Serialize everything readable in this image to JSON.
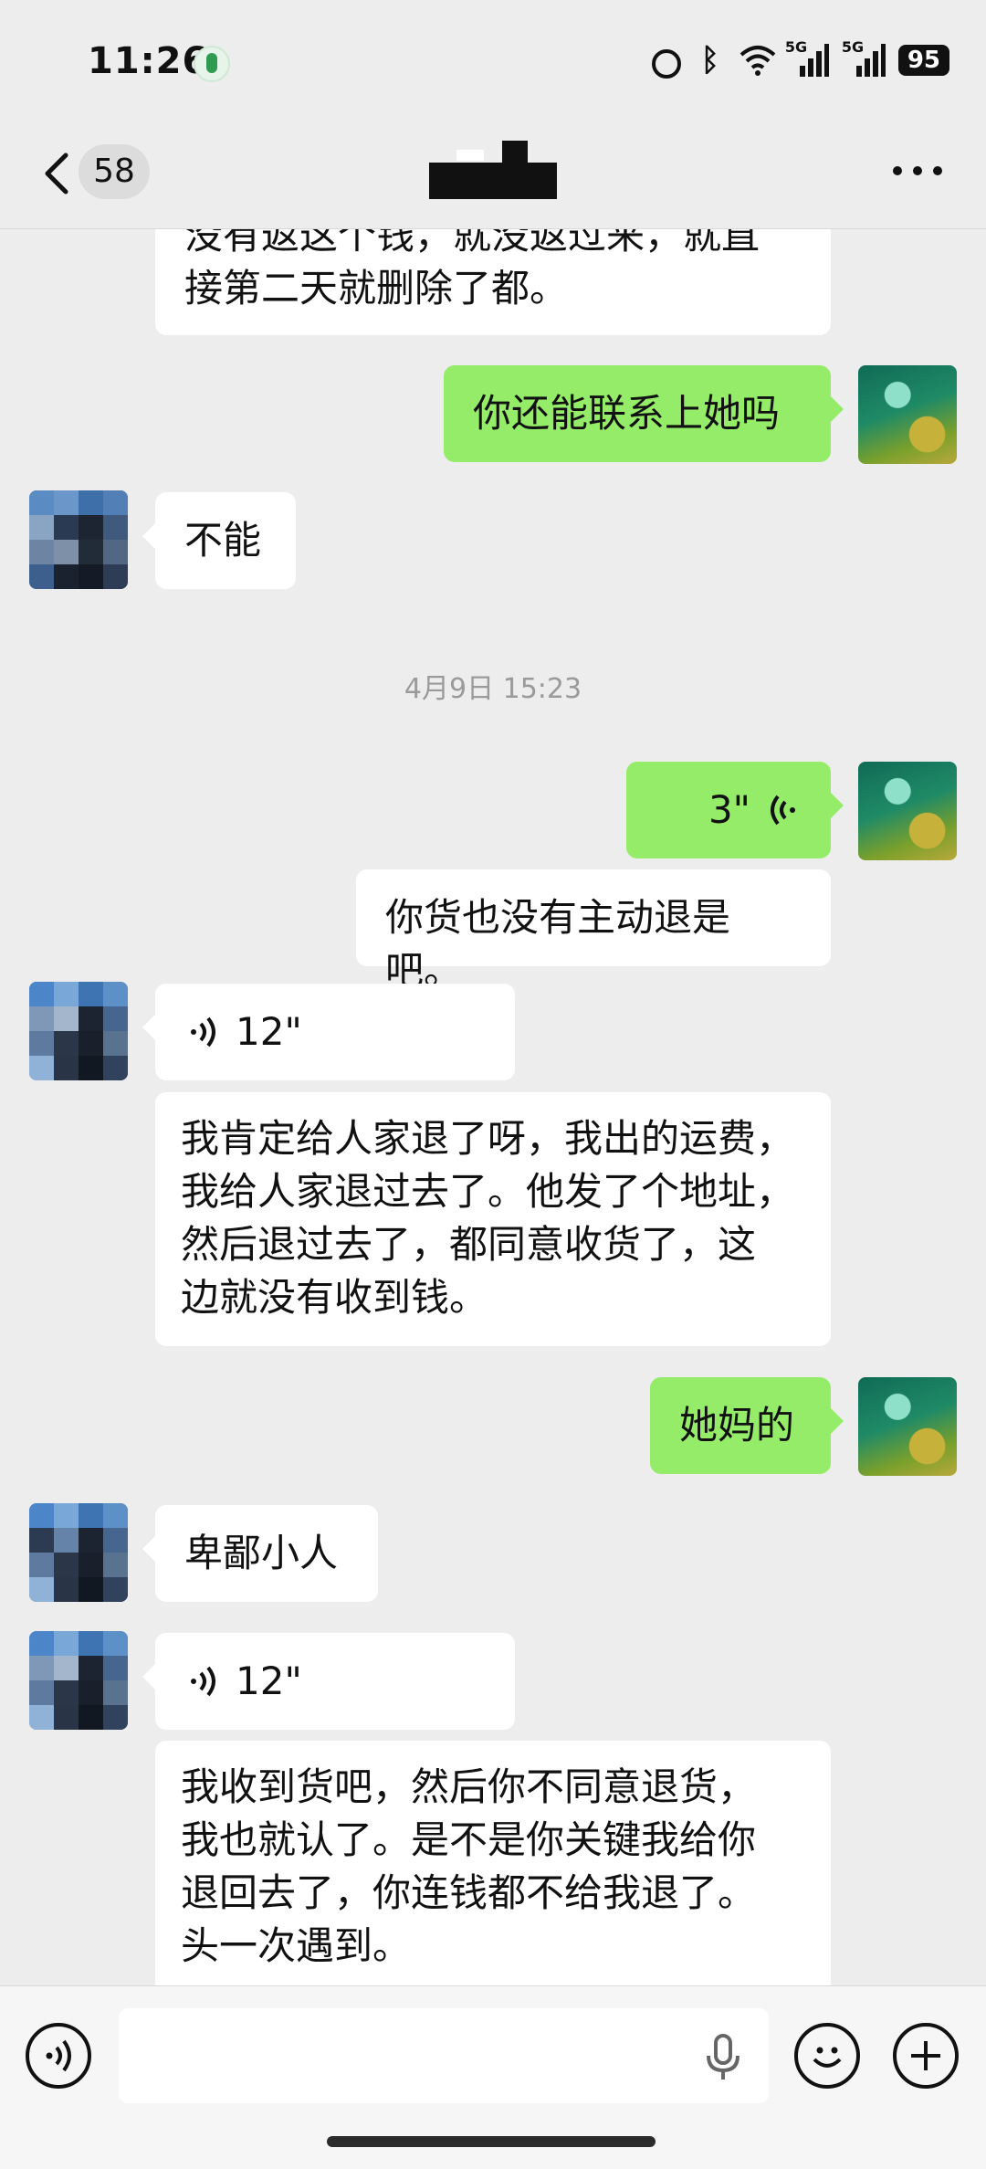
{
  "status_bar": {
    "time": "11:26",
    "network_1": "5G",
    "network_2": "5G",
    "battery": "95"
  },
  "header": {
    "unread_count": "58"
  },
  "messages": {
    "m1": {
      "lines": [
        "没有返这个钱，就没返过来，就直",
        "接第二天就删除了都。"
      ]
    },
    "m2": {
      "text": "你还能联系上她吗"
    },
    "m3": {
      "text": "不能"
    },
    "timestamp": "4月9日 15:23",
    "m4": {
      "duration": "3\""
    },
    "m5": {
      "text": "你货也没有主动退是吧。"
    },
    "m6": {
      "duration": "12\""
    },
    "m7": {
      "lines": [
        "我肯定给人家退了呀，我出的运费，",
        "我给人家退过去了。他发了个地址，",
        "然后退过去了，都同意收货了，这",
        "边就没有收到钱。"
      ]
    },
    "m8": {
      "text": "她妈的"
    },
    "m9": {
      "text": "卑鄙小人"
    },
    "m10": {
      "duration": "12\""
    },
    "m11": {
      "lines": [
        "我收到货吧，然后你不同意退货，",
        "我也就认了。是不是你关键我给你",
        "退回去了，你连钱都不给我退了。",
        "头一次遇到。"
      ]
    }
  },
  "colors": {
    "outgoing_bubble": "#95ec69",
    "incoming_bubble": "#ffffff",
    "background": "#ededed"
  }
}
